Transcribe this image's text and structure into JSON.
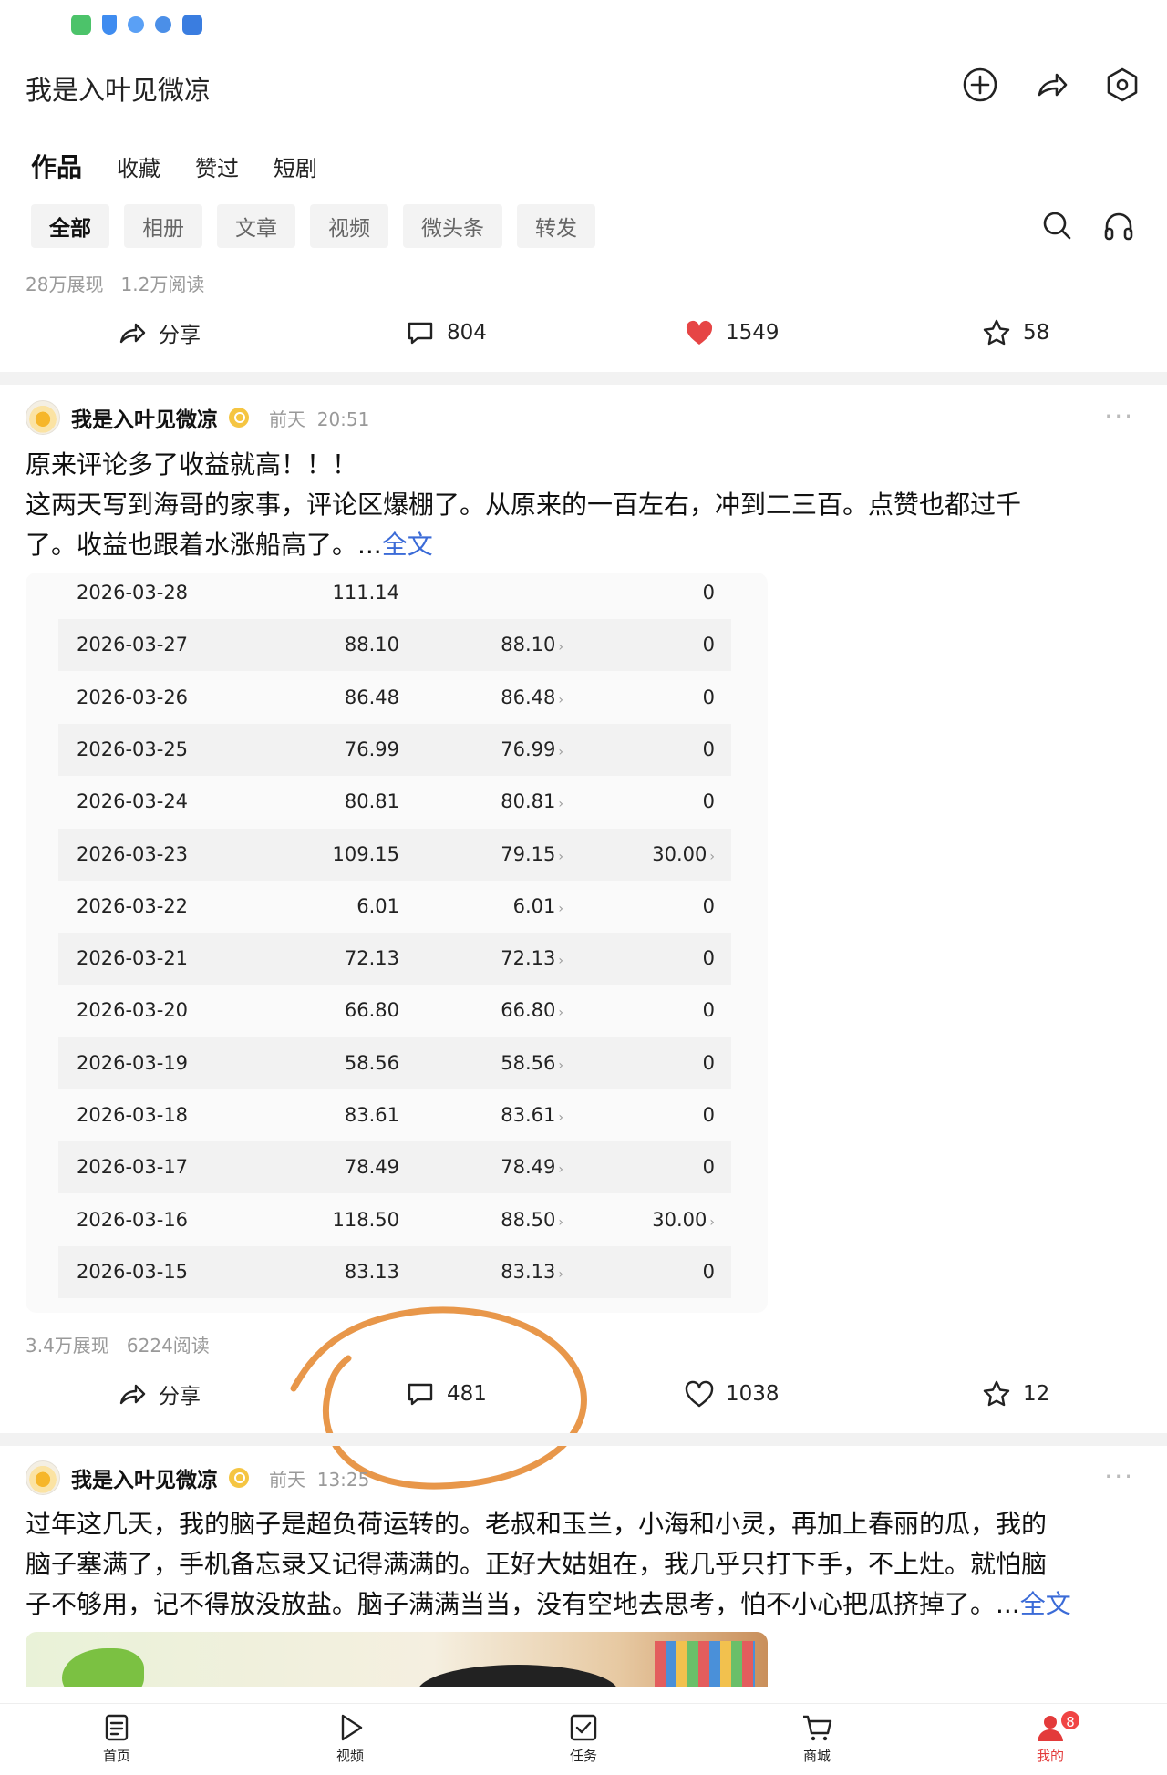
{
  "status_bar": {
    "icons": [
      "wechat-icon",
      "shield-icon",
      "globe-icon",
      "globe-icon",
      "cloud-icon"
    ]
  },
  "header": {
    "title": "我是入叶见微凉"
  },
  "tabs": [
    "作品",
    "收藏",
    "赞过",
    "短剧"
  ],
  "filters": [
    "全部",
    "相册",
    "文章",
    "视频",
    "微头条",
    "转发"
  ],
  "summary": {
    "impressions": "28万展现",
    "reads": "1.2万阅读"
  },
  "top_actions": {
    "share": "分享",
    "comments": "804",
    "likes": "1549",
    "favorites": "58"
  },
  "post1": {
    "author": "我是入叶见微凉",
    "day": "前天",
    "time": "20:51",
    "line1": "原来评论多了收益就高！！！",
    "line2": "这两天写到海哥的家事，评论区爆棚了。从原来的一百左右，冲到二三百。点赞也都过千",
    "line3": "了。收益也跟着水涨船高了。...",
    "read_more": "全文",
    "income_rows": [
      {
        "date": "2026-03-28",
        "total": "111.14",
        "base": "",
        "extra": "0"
      },
      {
        "date": "2026-03-27",
        "total": "88.10",
        "base": "88.10",
        "extra": "0"
      },
      {
        "date": "2026-03-26",
        "total": "86.48",
        "base": "86.48",
        "extra": "0"
      },
      {
        "date": "2026-03-25",
        "total": "76.99",
        "base": "76.99",
        "extra": "0"
      },
      {
        "date": "2026-03-24",
        "total": "80.81",
        "base": "80.81",
        "extra": "0"
      },
      {
        "date": "2026-03-23",
        "total": "109.15",
        "base": "79.15",
        "extra": "30.00"
      },
      {
        "date": "2026-03-22",
        "total": "6.01",
        "base": "6.01",
        "extra": "0"
      },
      {
        "date": "2026-03-21",
        "total": "72.13",
        "base": "72.13",
        "extra": "0"
      },
      {
        "date": "2026-03-20",
        "total": "66.80",
        "base": "66.80",
        "extra": "0"
      },
      {
        "date": "2026-03-19",
        "total": "58.56",
        "base": "58.56",
        "extra": "0"
      },
      {
        "date": "2026-03-18",
        "total": "83.61",
        "base": "83.61",
        "extra": "0"
      },
      {
        "date": "2026-03-17",
        "total": "78.49",
        "base": "78.49",
        "extra": "0"
      },
      {
        "date": "2026-03-16",
        "total": "118.50",
        "base": "88.50",
        "extra": "30.00"
      },
      {
        "date": "2026-03-15",
        "total": "83.13",
        "base": "83.13",
        "extra": "0"
      }
    ],
    "impressions": "3.4万展现",
    "reads": "6224阅读",
    "share": "分享",
    "comments": "481",
    "likes": "1038",
    "favorites": "12"
  },
  "post2": {
    "author": "我是入叶见微凉",
    "day": "前天",
    "time": "13:25",
    "line1": "过年这几天，我的脑子是超负荷运转的。老叔和玉兰，小海和小灵，再加上春丽的瓜，我的",
    "line2": "脑子塞满了，手机备忘录又记得满满的。正好大姑姐在，我几乎只打下手，不上灶。就怕脑",
    "line3": "子不够用，记不得放没放盐。脑子满满当当，没有空地去思考，怕不小心把瓜挤掉了。...",
    "read_more": "全文"
  },
  "bottom_nav": [
    {
      "label": "首页",
      "icon": "home-icon"
    },
    {
      "label": "视频",
      "icon": "play-icon"
    },
    {
      "label": "任务",
      "icon": "task-icon"
    },
    {
      "label": "商城",
      "icon": "cart-icon"
    },
    {
      "label": "我的",
      "icon": "profile-icon",
      "badge": "8"
    }
  ],
  "colors": {
    "like_red": "#e64545",
    "link_blue": "#3b6bd7",
    "annotation_orange": "#e8974a",
    "nav_active": "#e33b3b"
  }
}
